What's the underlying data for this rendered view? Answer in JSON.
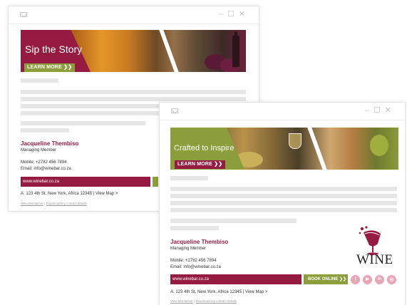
{
  "colors": {
    "brand": "#951b43",
    "accent": "#8c9d3b",
    "social": "#e7a5b6"
  },
  "window_icons": {
    "mail": "mail-icon",
    "minimize": "minimize-icon",
    "maximize": "maximize-icon",
    "close": "close-icon"
  },
  "window_controls": {
    "min": "–",
    "max": "☐",
    "close": "✕"
  },
  "email1": {
    "banner": {
      "title": "Sip the Story",
      "button": "LEARN MORE ❯❯"
    },
    "signature": {
      "name": "Jacqueline Thembiso",
      "role": "Managing Member",
      "mobile_label": "Mobile:",
      "mobile": "+2782 456 7894",
      "email_label": "Email:",
      "email": "info@winebar.co.za",
      "website": "www.winebar.co.za",
      "address": "A: 123 4th St, New York, Africa 12345",
      "separator": "|",
      "map_link": "View Map >",
      "disclaimer": "View Disclaimer",
      "footer_separator": "|",
      "download": "Download my contact details"
    }
  },
  "email2": {
    "banner": {
      "title": "Crafted to Inspire",
      "button": "LEARN MORE ❯❯"
    },
    "signature": {
      "name": "Jacqueline Thembiso",
      "role": "Managing Member",
      "mobile_label": "Mobile:",
      "mobile": "+2782 456 7894",
      "email_label": "Email:",
      "email": "info@winebar.co.za",
      "website": "www.winebar.co.za",
      "book_button": "BOOK ONLINE ❯❯",
      "address": "A: 123 4th St, New York, Africa 12345",
      "separator": "|",
      "map_link": "View Map >",
      "disclaimer": "View Disclaimer",
      "footer_separator": "|",
      "download": "Download my contact details"
    },
    "logo": {
      "text": "WINE"
    },
    "social": [
      {
        "icon": "facebook-icon",
        "glyph": "f"
      },
      {
        "icon": "youtube-icon",
        "glyph": "▶"
      },
      {
        "icon": "linkedin-icon",
        "glyph": "in"
      },
      {
        "icon": "instagram-icon",
        "glyph": "◎"
      }
    ]
  }
}
